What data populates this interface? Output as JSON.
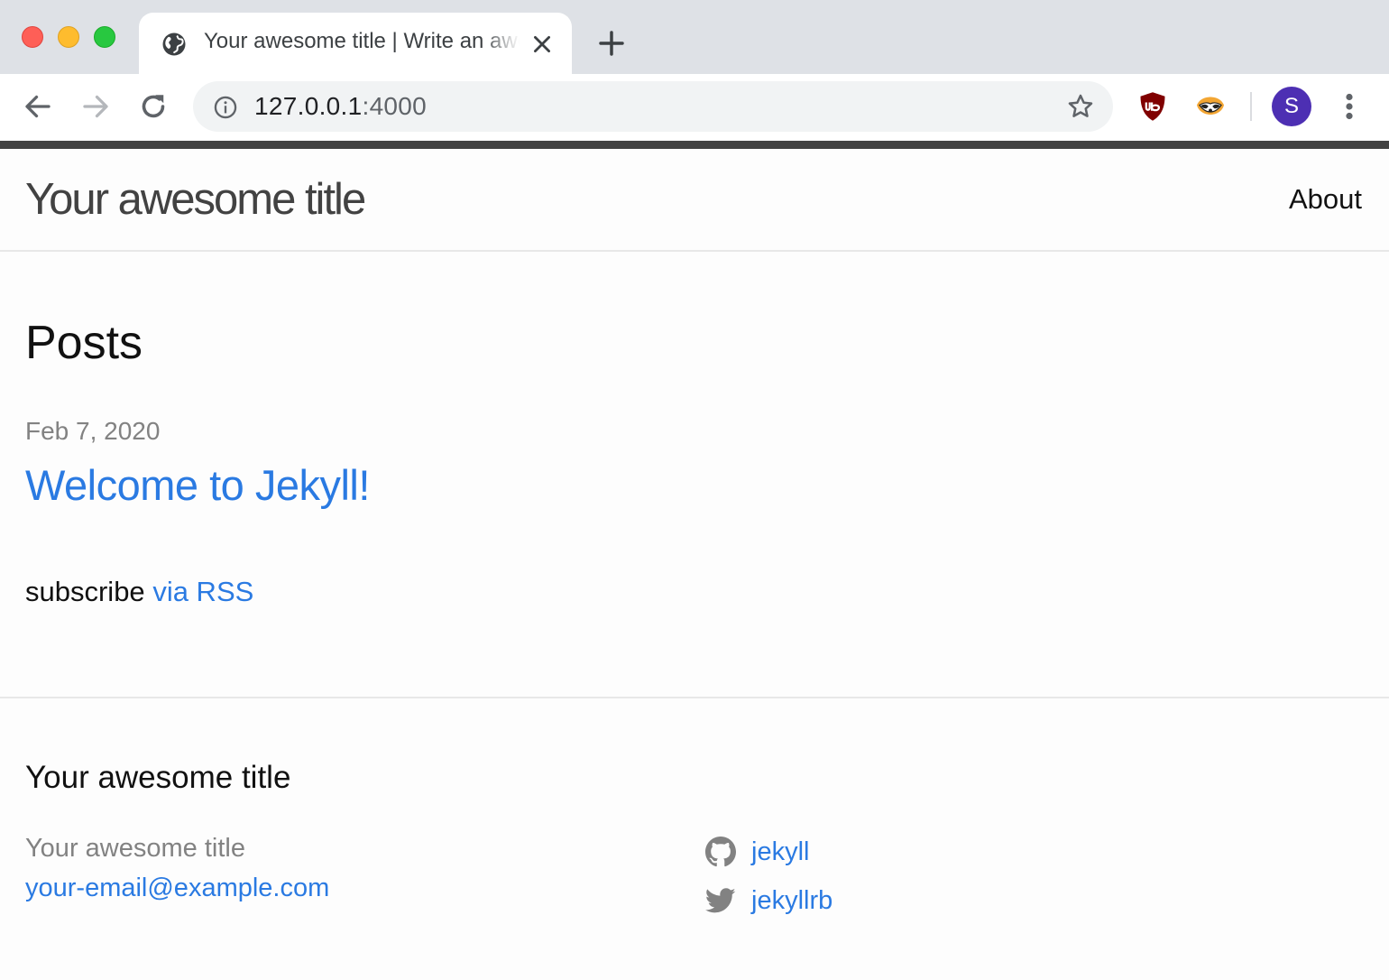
{
  "browser": {
    "tab": {
      "title": "Your awesome title | Write an awesome description for your new site here."
    },
    "address_bar": {
      "host": "127.0.0.1",
      "port": ":4000"
    },
    "profile_initial": "S",
    "extensions": [
      "ublock-origin-icon",
      "privacy-badger-icon"
    ],
    "icons": [
      "globe-icon",
      "close-icon",
      "plus-icon",
      "back-arrow-icon",
      "forward-arrow-icon",
      "reload-icon",
      "info-icon",
      "star-icon",
      "more-vert-icon"
    ]
  },
  "site": {
    "header": {
      "title": "Your awesome title",
      "nav": [
        "About"
      ]
    },
    "main": {
      "heading": "Posts",
      "posts": [
        {
          "date": "Feb 7, 2020",
          "title": "Welcome to Jekyll!"
        }
      ],
      "subscribe_text": "subscribe",
      "subscribe_link": "via RSS"
    },
    "footer": {
      "heading": "Your awesome title",
      "name": "Your awesome title",
      "email": "your-email@example.com",
      "social": [
        {
          "icon": "github-icon",
          "label": "jekyll"
        },
        {
          "icon": "twitter-icon",
          "label": "jekyllrb"
        }
      ]
    }
  },
  "colors": {
    "link": "#2a7ae2",
    "text": "#111111",
    "muted": "#828282",
    "top_border": "#424242",
    "avatar": "#4d2fb3"
  }
}
